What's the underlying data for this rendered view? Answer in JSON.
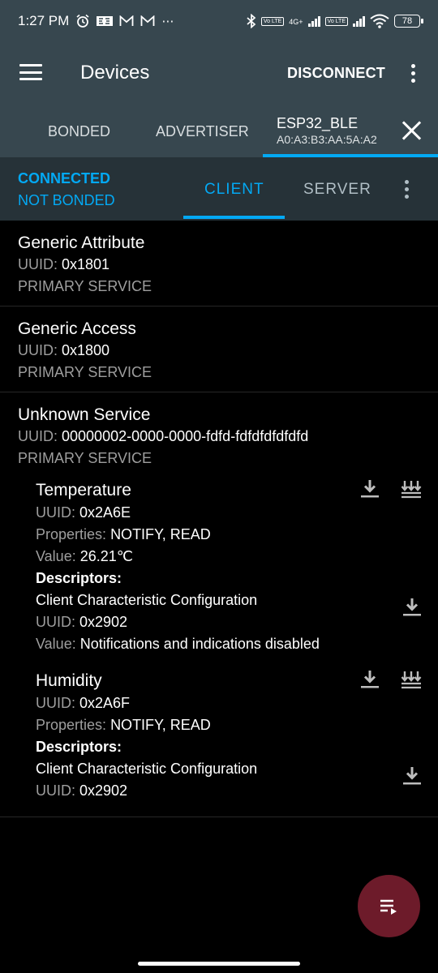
{
  "status_bar": {
    "time": "1:27 PM",
    "volte_label": "Vo LTE",
    "network": "4G+",
    "battery": "78"
  },
  "app_bar": {
    "title": "Devices",
    "disconnect_label": "DISCONNECT"
  },
  "device_tabs": {
    "bonded": "BONDED",
    "advertiser": "ADVERTISER",
    "active_name": "ESP32_BLE",
    "active_address": "A0:A3:B3:AA:5A:A2"
  },
  "connection": {
    "status": "CONNECTED",
    "bond": "NOT BONDED",
    "tab_client": "CLIENT",
    "tab_server": "SERVER"
  },
  "labels": {
    "uuid": "UUID:",
    "properties": "Properties:",
    "value": "Value:",
    "descriptors": "Descriptors:"
  },
  "services": [
    {
      "name": "Generic Attribute",
      "uuid": "0x1801",
      "type": "PRIMARY SERVICE"
    },
    {
      "name": "Generic Access",
      "uuid": "0x1800",
      "type": "PRIMARY SERVICE"
    },
    {
      "name": "Unknown Service",
      "uuid": "00000002-0000-0000-fdfd-fdfdfdfdfdfd",
      "type": "PRIMARY SERVICE",
      "characteristics": [
        {
          "name": "Temperature",
          "uuid": "0x2A6E",
          "properties": "NOTIFY, READ",
          "value": "26.21℃",
          "descriptor": {
            "name": "Client Characteristic Configuration",
            "uuid": "0x2902",
            "value": "Notifications and indications disabled"
          }
        },
        {
          "name": "Humidity",
          "uuid": "0x2A6F",
          "properties": "NOTIFY, READ",
          "descriptor": {
            "name": "Client Characteristic Configuration",
            "uuid": "0x2902"
          }
        }
      ]
    }
  ],
  "icons": {
    "menu": "hamburger-menu-icon",
    "overflow": "more-vert-icon",
    "close": "close-icon",
    "read": "download-icon",
    "notify": "notify-icon",
    "log": "log-list-icon"
  },
  "colors": {
    "app_bar": "#37474f",
    "connection_bar": "#263238",
    "accent": "#03a9f4",
    "fab": "#6d1b2a",
    "background": "#000000"
  }
}
